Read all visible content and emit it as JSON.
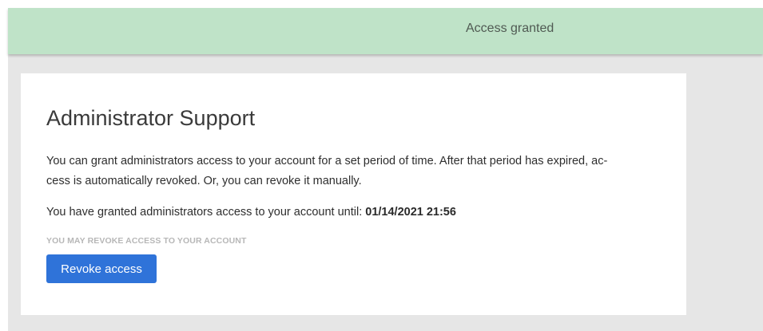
{
  "banner": {
    "message": "Access granted"
  },
  "card": {
    "title": "Administrator Support",
    "description_lines": [
      "You can grant administrators access to your account for a set period of time. After that period has expired, ac-",
      "cess is automatically revoked. Or, you can revoke it manually."
    ],
    "status_prefix": "You have granted administrators access to your account until: ",
    "status_date": "01/14/2021 21:56",
    "revoke_caption": "YOU MAY REVOKE ACCESS TO YOUR ACCOUNT",
    "revoke_button_label": "Revoke access"
  },
  "colors": {
    "banner_background": "#bfe3c8",
    "page_background": "#e6e6e6",
    "card_background": "#ffffff",
    "primary_button": "#2f73d9"
  }
}
